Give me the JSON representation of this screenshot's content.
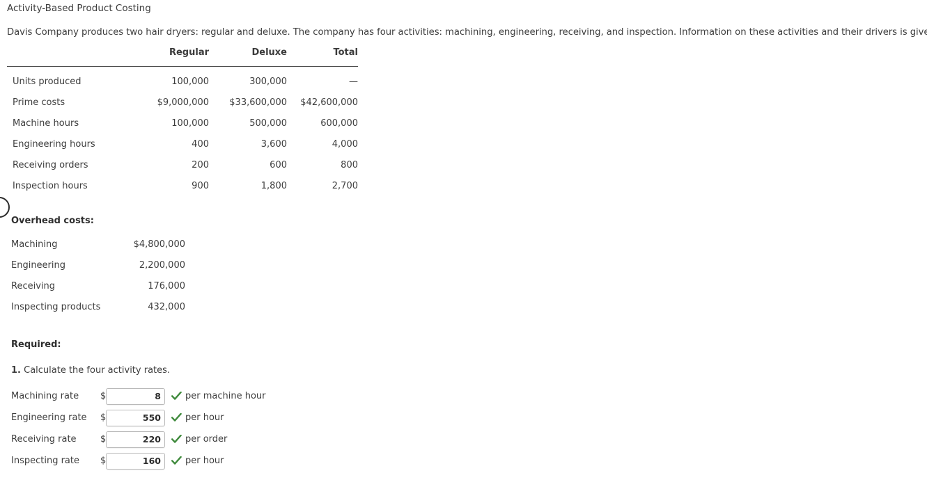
{
  "document": {
    "title": "Activity-Based Product Costing",
    "intro": "Davis Company produces two hair dryers: regular and deluxe. The company has four activities: machining, engineering, receiving, and inspection. Information on these activities and their drivers is given below."
  },
  "driver_table": {
    "columns": [
      "",
      "Regular",
      "Deluxe",
      "Total"
    ],
    "rows": [
      {
        "label": "Units produced",
        "regular": "100,000",
        "deluxe": "300,000",
        "total": "—"
      },
      {
        "label": "Prime costs",
        "regular": "$9,000,000",
        "deluxe": "$33,600,000",
        "total": "$42,600,000"
      },
      {
        "label": "Machine hours",
        "regular": "100,000",
        "deluxe": "500,000",
        "total": "600,000"
      },
      {
        "label": "Engineering hours",
        "regular": "400",
        "deluxe": "3,600",
        "total": "4,000"
      },
      {
        "label": "Receiving orders",
        "regular": "200",
        "deluxe": "600",
        "total": "800"
      },
      {
        "label": "Inspection hours",
        "regular": "900",
        "deluxe": "1,800",
        "total": "2,700"
      }
    ]
  },
  "overhead": {
    "heading": "Overhead costs:",
    "rows": [
      {
        "label": "Machining",
        "value": "$4,800,000"
      },
      {
        "label": "Engineering",
        "value": "2,200,000"
      },
      {
        "label": "Receiving",
        "value": "176,000"
      },
      {
        "label": "Inspecting products",
        "value": "432,000"
      }
    ]
  },
  "required": {
    "heading": "Required:",
    "question_number": "1.",
    "question_text": " Calculate the four activity rates.",
    "rates": [
      {
        "label": "Machining rate",
        "currency": "$",
        "value": "8",
        "unit": "per machine hour",
        "status": "correct"
      },
      {
        "label": "Engineering rate",
        "currency": "$",
        "value": "550",
        "unit": "per hour",
        "status": "correct"
      },
      {
        "label": "Receiving rate",
        "currency": "$",
        "value": "220",
        "unit": "per order",
        "status": "correct"
      },
      {
        "label": "Inspecting rate",
        "currency": "$",
        "value": "160",
        "unit": "per hour",
        "status": "correct"
      }
    ]
  },
  "colors": {
    "text": "#3d3d3d",
    "rule": "#4a4a4a",
    "check_green": "#3f8a3c",
    "input_border": "#b9b9b9"
  }
}
